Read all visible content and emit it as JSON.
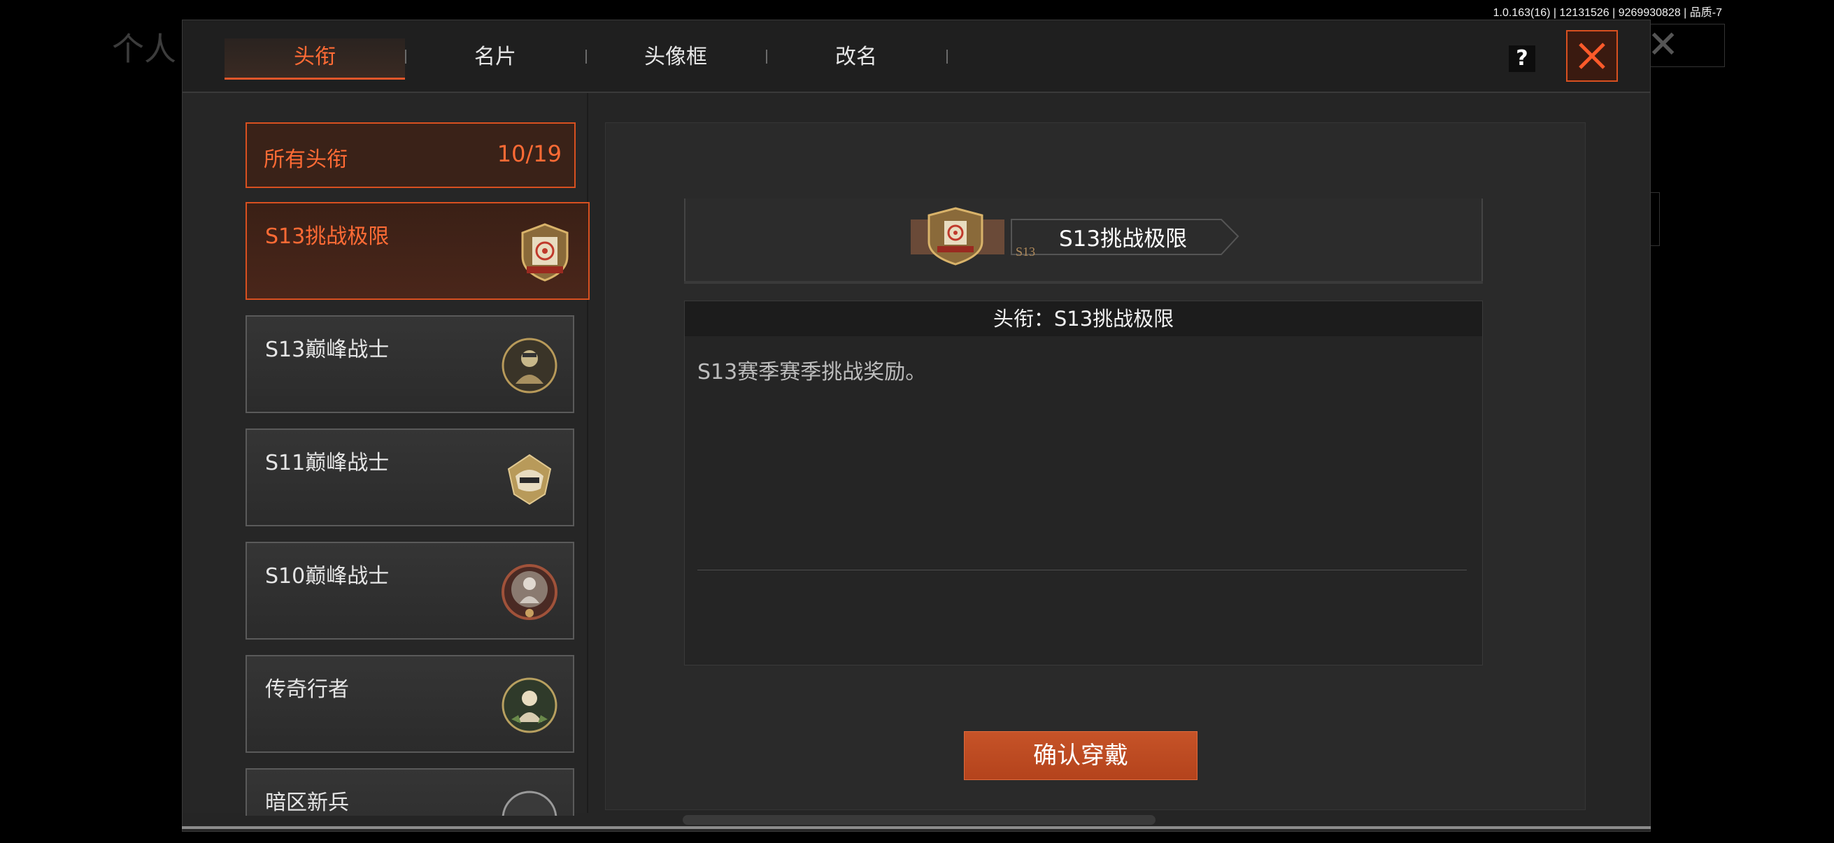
{
  "version_info": "1.0.163(16) | 12131526 | 9269930828 | 品质-7",
  "background": {
    "title": "个人"
  },
  "tabs": [
    {
      "label": "头衔",
      "active": true
    },
    {
      "label": "名片",
      "active": false
    },
    {
      "label": "头像框",
      "active": false
    },
    {
      "label": "改名",
      "active": false
    }
  ],
  "help_label": "?",
  "all_titles": {
    "label": "所有头衔",
    "count": "10/19"
  },
  "title_list": [
    {
      "label": "S13挑战极限",
      "icon": "target-medal-icon",
      "active": true
    },
    {
      "label": "S13巅峰战士",
      "icon": "soldier-medal-icon",
      "active": false
    },
    {
      "label": "S11巅峰战士",
      "icon": "helmet-medal-icon",
      "active": false
    },
    {
      "label": "S10巅峰战士",
      "icon": "wreath-soldier-medal-icon",
      "active": false
    },
    {
      "label": "传奇行者",
      "icon": "legend-medal-icon",
      "active": false
    },
    {
      "label": "暗区新兵",
      "icon": "recruit-medal-icon",
      "active": false
    }
  ],
  "preview": {
    "title": "S13挑战极限",
    "season_tag": "S13"
  },
  "detail": {
    "header": "头衔：S13挑战极限",
    "description": "S13赛季赛季挑战奖励。"
  },
  "confirm_label": "确认穿戴",
  "colors": {
    "accent": "#e0562a",
    "panel": "#252525",
    "text": "#e6e6e6"
  }
}
